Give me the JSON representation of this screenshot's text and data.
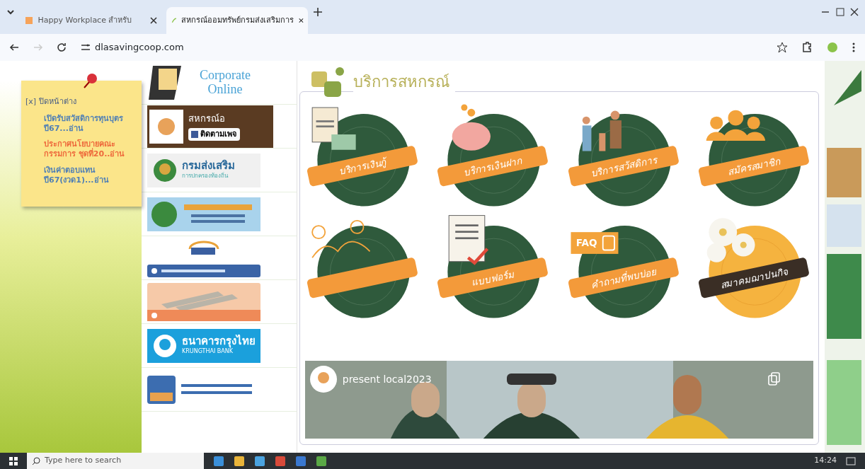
{
  "browser": {
    "tabs": [
      {
        "title": "Happy Workplace สำหรับ",
        "selected": false
      },
      {
        "title": "สหกรณ์ออมทรัพย์กรมส่งเสริมการ",
        "selected": true
      }
    ],
    "address": "dlasavingcoop.com"
  },
  "notice": {
    "close": "[x] ปิดหน้าต่าง",
    "items": [
      {
        "text": "เปิดรับสวัสดิการทุนบุตร ปี67...อ่าน",
        "color": "#4f7fb5"
      },
      {
        "text": "ประกาศนโยบายคณะกรรมการ ชุดที่20..อ่าน",
        "color": "#ee6a3c"
      },
      {
        "text": "เงินค่าตอบแทน ปี67(งวด1)...อ่าน",
        "color": "#4f7fb5"
      }
    ]
  },
  "sidebar_links": [
    {
      "kind": "ktb",
      "title": "Corporate Online"
    },
    {
      "kind": "facebook",
      "title": "สหกรณ์อ",
      "button": "ติดตามเพจ"
    },
    {
      "kind": "dept",
      "title": "กรมส่งเสริม",
      "subtitle": "การปกครองท้องถิ่น"
    },
    {
      "kind": "blue-banner"
    },
    {
      "kind": "center"
    },
    {
      "kind": "orange-banner"
    },
    {
      "kind": "ktb-bank",
      "title": "ธนาคารกรุงไทย",
      "subtitle": "KRUNGTHAI BANK"
    },
    {
      "kind": "bank-logo"
    }
  ],
  "services": {
    "title": "บริการสหกรณ์",
    "items": [
      {
        "kind": "loan",
        "label": "บริการเงินกู้"
      },
      {
        "kind": "deposit",
        "label": "บริการเงินฝาก"
      },
      {
        "kind": "welfare",
        "label": "บริการสวัสดิการ"
      },
      {
        "kind": "members",
        "label": "สมัครสมาชิก"
      },
      {
        "kind": "contact"
      },
      {
        "kind": "form",
        "label": "แบบฟอร์ม"
      },
      {
        "kind": "faq",
        "label": "คำถามที่พบบ่อย",
        "badge": "FAQ"
      },
      {
        "kind": "flowers",
        "label": "สมาคมฌาปนกิจ"
      }
    ]
  },
  "video": {
    "channel": "present local2023"
  },
  "taskbar": {
    "search_placeholder": "Type here to search",
    "time": "14:24"
  }
}
